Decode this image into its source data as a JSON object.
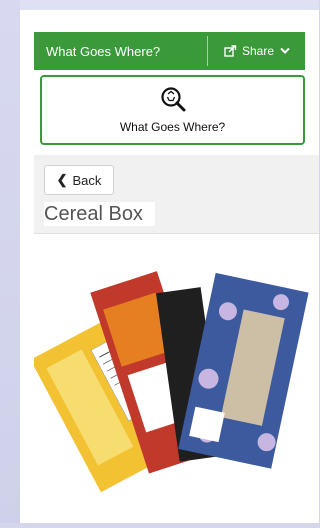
{
  "header": {
    "title": "What Goes Where?",
    "share_label": "Share"
  },
  "hero": {
    "label": "What Goes Where?",
    "icon": "magnifier-recycle-icon"
  },
  "nav": {
    "back_label": "Back"
  },
  "item": {
    "title": "Cereal Box"
  },
  "colors": {
    "brand_green": "#3a9a3a"
  }
}
